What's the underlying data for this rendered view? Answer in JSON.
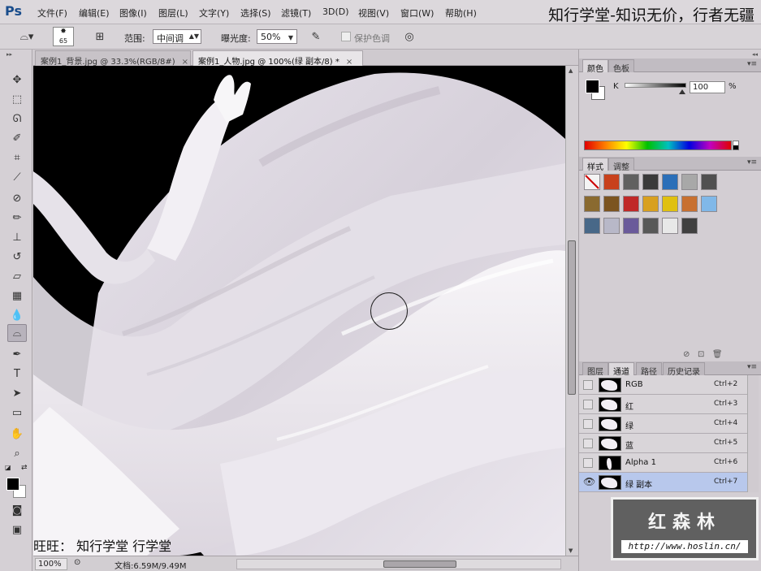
{
  "app": {
    "logo": "Ps",
    "overlay_title": "知行学堂-知识无价，行者无疆",
    "menus": [
      "文件(F)",
      "编辑(E)",
      "图像(I)",
      "图层(L)",
      "文字(Y)",
      "选择(S)",
      "滤镜(T)",
      "3D(D)",
      "视图(V)",
      "窗口(W)",
      "帮助(H)"
    ]
  },
  "options": {
    "brush_size": "65",
    "range_label": "范围:",
    "range_value": "中间调",
    "exposure_label": "曝光度:",
    "exposure_value": "50%",
    "protect_tones_label": "保护色调",
    "protect_tones_checked": false
  },
  "tools": [
    "move-tool",
    "marquee-tool",
    "lasso-tool",
    "quick-select-tool",
    "crop-tool",
    "eyedropper-tool",
    "healing-brush-tool",
    "brush-tool",
    "clone-stamp-tool",
    "history-brush-tool",
    "eraser-tool",
    "gradient-tool",
    "blur-tool",
    "dodge-tool",
    "pen-tool",
    "type-tool",
    "path-select-tool",
    "rectangle-tool",
    "hand-tool",
    "zoom-tool"
  ],
  "active_tool": "dodge-tool",
  "tabs": [
    {
      "label": "案例1_背景.jpg @ 33.3%(RGB/8#)",
      "active": false
    },
    {
      "label": "案例1_人物.jpg @ 100%(绿 副本/8) *",
      "active": true
    }
  ],
  "canvas": {
    "caption": "旺旺： 知行学堂                行学堂"
  },
  "status": {
    "zoom": "100%",
    "doc_info": "文档:6.59M/9.49M"
  },
  "color_panel": {
    "tabs": [
      "颜色",
      "色板"
    ],
    "channel_label": "K",
    "value": "100",
    "unit": "%"
  },
  "styles_panel": {
    "tabs": [
      "样式",
      "调整"
    ],
    "swatches": [
      "#f4f4f4",
      "#c8401c",
      "#606060",
      "#3a3a3a",
      "#2b6fb8",
      "#a8a8a8",
      "#505050",
      "#8a6a30",
      "#7c5420",
      "#c02828",
      "#d8a020",
      "#e0c010",
      "#c87030",
      "#80b8e8",
      "#486888",
      "#b8b8c8",
      "#6a5a9a",
      "#585858",
      "#e8e8e8",
      "#404040"
    ]
  },
  "channels_panel": {
    "tabs": [
      "图层",
      "通道",
      "路径",
      "历史记录"
    ],
    "rows": [
      {
        "name": "RGB",
        "shortcut": "Ctrl+2",
        "visible": false,
        "selected": false
      },
      {
        "name": "红",
        "shortcut": "Ctrl+3",
        "visible": false,
        "selected": false
      },
      {
        "name": "绿",
        "shortcut": "Ctrl+4",
        "visible": false,
        "selected": false
      },
      {
        "name": "蓝",
        "shortcut": "Ctrl+5",
        "visible": false,
        "selected": false
      },
      {
        "name": "Alpha 1",
        "shortcut": "Ctrl+6",
        "visible": false,
        "selected": false
      },
      {
        "name": "绿 副本",
        "shortcut": "Ctrl+7",
        "visible": true,
        "selected": true
      }
    ]
  },
  "watermark": {
    "name": "红森林",
    "url": "http://www.hoslin.cn/"
  }
}
